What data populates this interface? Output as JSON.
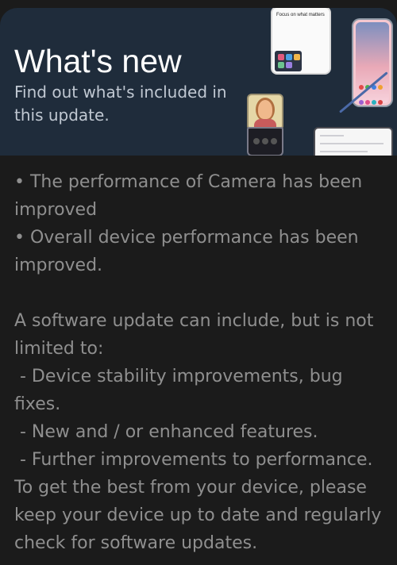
{
  "banner": {
    "title": "What's new",
    "subtitle": "Find out what's included in this update."
  },
  "illustration": {
    "phone_screen_text": "Focus on what matters"
  },
  "notes": {
    "bullets": [
      "• The performance of Camera has been improved",
      "• Overall device performance has been improved."
    ],
    "intro": "A software update can include, but is not limited to:",
    "items": [
      " - Device stability improvements, bug fixes.",
      " - New and / or enhanced features.",
      " - Further improvements to performance."
    ],
    "closing": "To get the best from your device, please keep your device up to date and regularly check for software updates."
  },
  "colors": {
    "background": "#1b1b1b",
    "banner": "#1f2c3b",
    "title": "#ffffff",
    "subtitle": "#c0c8d2",
    "body_text": "#8f8f8f"
  }
}
